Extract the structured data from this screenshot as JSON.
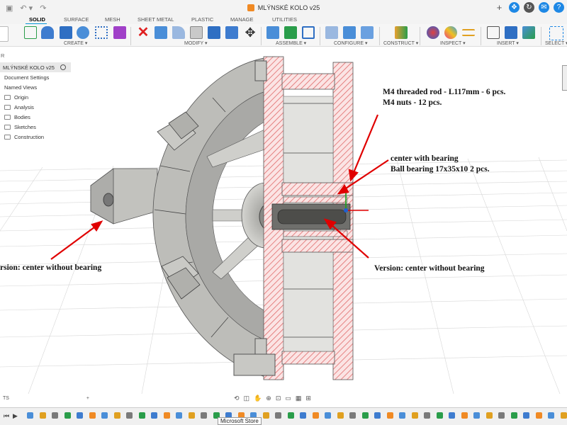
{
  "window": {
    "title": "MLÝNSKÉ KOLO v25"
  },
  "workspace_tabs": [
    "SOLID",
    "SURFACE",
    "MESH",
    "SHEET METAL",
    "PLASTIC",
    "MANAGE",
    "UTILITIES"
  ],
  "toolbar_groups": [
    "CREATE ▾",
    "MODIFY ▾",
    "ASSEMBLE ▾",
    "CONFIGURE ▾",
    "CONSTRUCT ▾",
    "INSPECT ▾",
    "INSERT ▾",
    "SELECT ▾"
  ],
  "browser": {
    "header": "R",
    "root": "MLÝNSKÉ KOLO v25",
    "items": [
      "Document Settings",
      "Named Views",
      "Origin",
      "Analysis",
      "Bodies",
      "Sketches",
      "Construction"
    ]
  },
  "comments": {
    "label": "TS",
    "add": "+"
  },
  "annotations": {
    "rod": "M4 threaded rod - L117mm - 6 pcs.",
    "nuts": "M4 nuts - 12 pcs.",
    "center": "center with bearing",
    "bearing": "Ball bearing 17x35x10  2 pcs.",
    "left_version": "rsion: center without bearing",
    "right_version": "Version: center without bearing"
  },
  "tooltip": "Microsoft Store",
  "colors": {
    "accent": "#0696d7",
    "annotation_arrow": "#e00000",
    "section_hatch": "#e06a6a",
    "model_gray": "#b8b8b4"
  }
}
